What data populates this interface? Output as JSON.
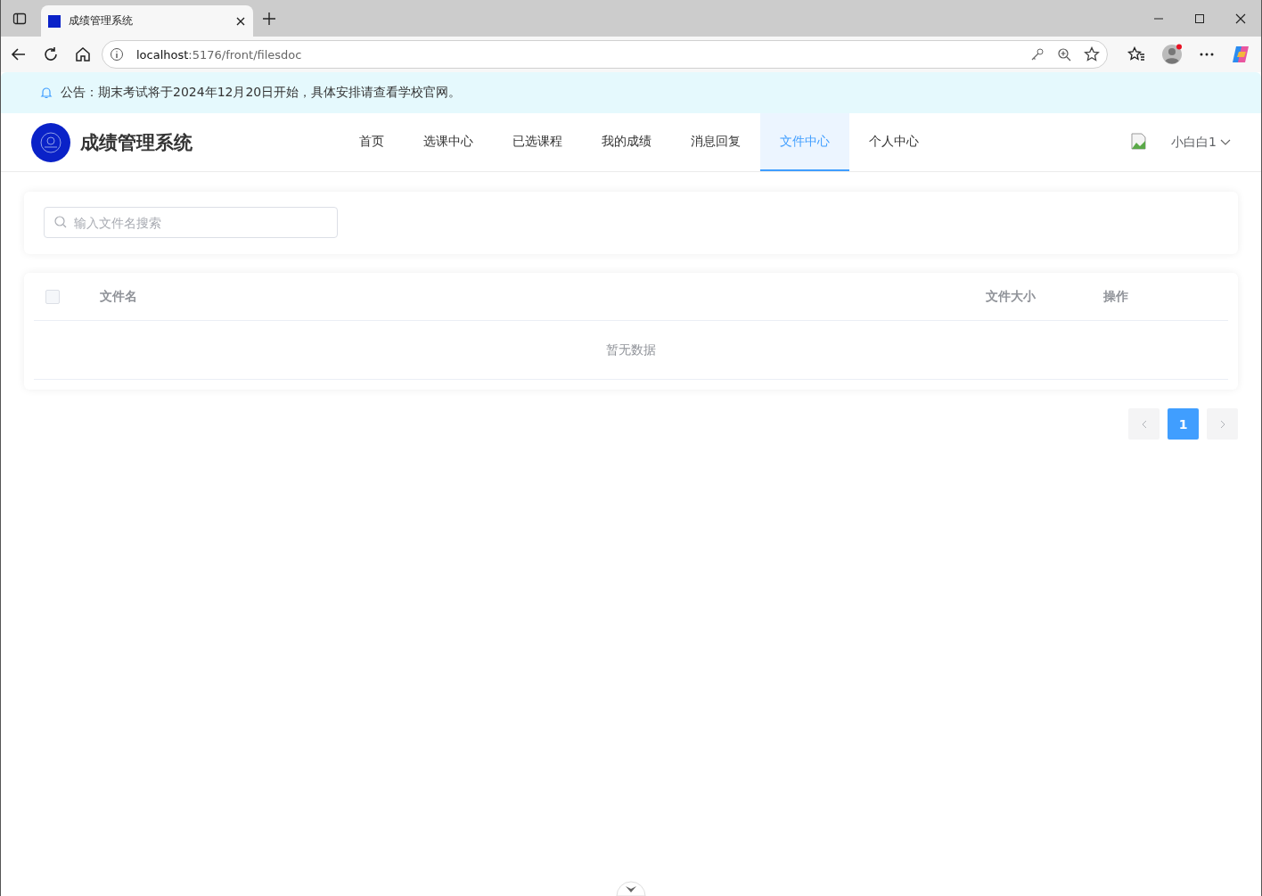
{
  "browser": {
    "tab_title": "成绩管理系统",
    "url_host": "localhost",
    "url_path": ":5176/front/filesdoc"
  },
  "notice": {
    "text": "公告：期末考试将于2024年12月20日开始，具体安排请查看学校官网。"
  },
  "header": {
    "logo_text": "成绩管理系统",
    "nav": [
      {
        "label": "首页",
        "selected": false
      },
      {
        "label": "选课中心",
        "selected": false
      },
      {
        "label": "已选课程",
        "selected": false
      },
      {
        "label": "我的成绩",
        "selected": false
      },
      {
        "label": "消息回复",
        "selected": false
      },
      {
        "label": "文件中心",
        "selected": true
      },
      {
        "label": "个人中心",
        "selected": false
      }
    ],
    "user": "小白白1"
  },
  "search": {
    "placeholder": "输入文件名搜索"
  },
  "table": {
    "select_all_checked": false,
    "columns": [
      "文件名",
      "文件大小",
      "操作"
    ],
    "empty_text": "暂无数据"
  },
  "pagination": {
    "pages": [
      {
        "label": "1",
        "selected": true
      }
    ]
  }
}
